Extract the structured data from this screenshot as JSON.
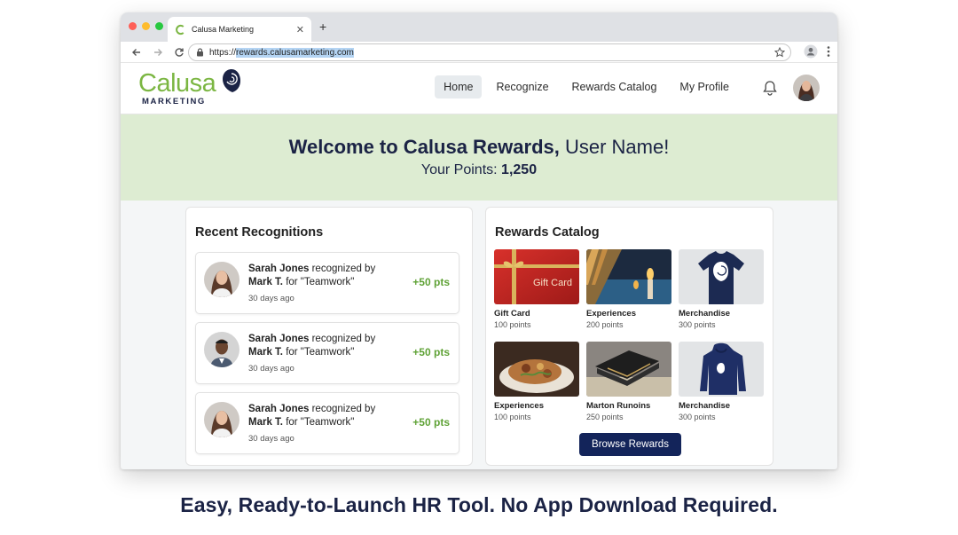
{
  "browser": {
    "tab_title": "Calusa Marketing",
    "url_prefix": "https://",
    "url_host": "rewards.calusamarketing.com",
    "traffic_colors": [
      "#fe5f57",
      "#febc2e",
      "#28c840"
    ]
  },
  "brand": {
    "logo_word": "Calusa",
    "logo_sub": "MARKETING",
    "green": "#7bb642",
    "navy": "#1b2345"
  },
  "nav": {
    "items": [
      {
        "label": "Home",
        "active": true
      },
      {
        "label": "Recognize",
        "active": false
      },
      {
        "label": "Rewards Catalog",
        "active": false
      },
      {
        "label": "My Profile",
        "active": false
      }
    ]
  },
  "welcome": {
    "heading_bold": "Welcome to Calusa Rewards,",
    "heading_user": " User Name!",
    "points_label": "Your Points: ",
    "points_value": "1,250"
  },
  "recent": {
    "title": "Recent Recognitions",
    "items": [
      {
        "recipient": "Sarah Jones",
        "verb": " recognized by",
        "giver": "Mark T.",
        "reason": " for \"Teamwork\"",
        "date": "30 days ago",
        "points": "+50 pts"
      },
      {
        "recipient": "Sarah Jones",
        "verb": " recognized by",
        "giver": "Mark T.",
        "reason": " for \"Teamwork\"",
        "date": "30 days ago",
        "points": "+50 pts"
      },
      {
        "recipient": "Sarah Jones",
        "verb": " recognized by",
        "giver": "Mark T.",
        "reason": " for \"Teamwork\"",
        "date": "30 days ago",
        "points": "+50 pts"
      }
    ]
  },
  "catalog": {
    "title": "Rewards Catalog",
    "gift_card_label": "Gift Card",
    "items": [
      {
        "name": "Gift Card",
        "points": "100 points",
        "icon": "gift-card-image"
      },
      {
        "name": "Experiences",
        "points": "200 points",
        "icon": "experience-image"
      },
      {
        "name": "Merchandise",
        "points": "300 points",
        "icon": "tshirt-image"
      },
      {
        "name": "Experiences",
        "points": "100 points",
        "icon": "food-image"
      },
      {
        "name": "Marton Runoins",
        "points": "250 points",
        "icon": "wallet-image"
      },
      {
        "name": "Merchandise",
        "points": "300 points",
        "icon": "hoodie-image"
      }
    ],
    "button_label": "Browse Rewards"
  },
  "tagline": "Easy, Ready-to-Launch HR Tool. No App Download Required."
}
